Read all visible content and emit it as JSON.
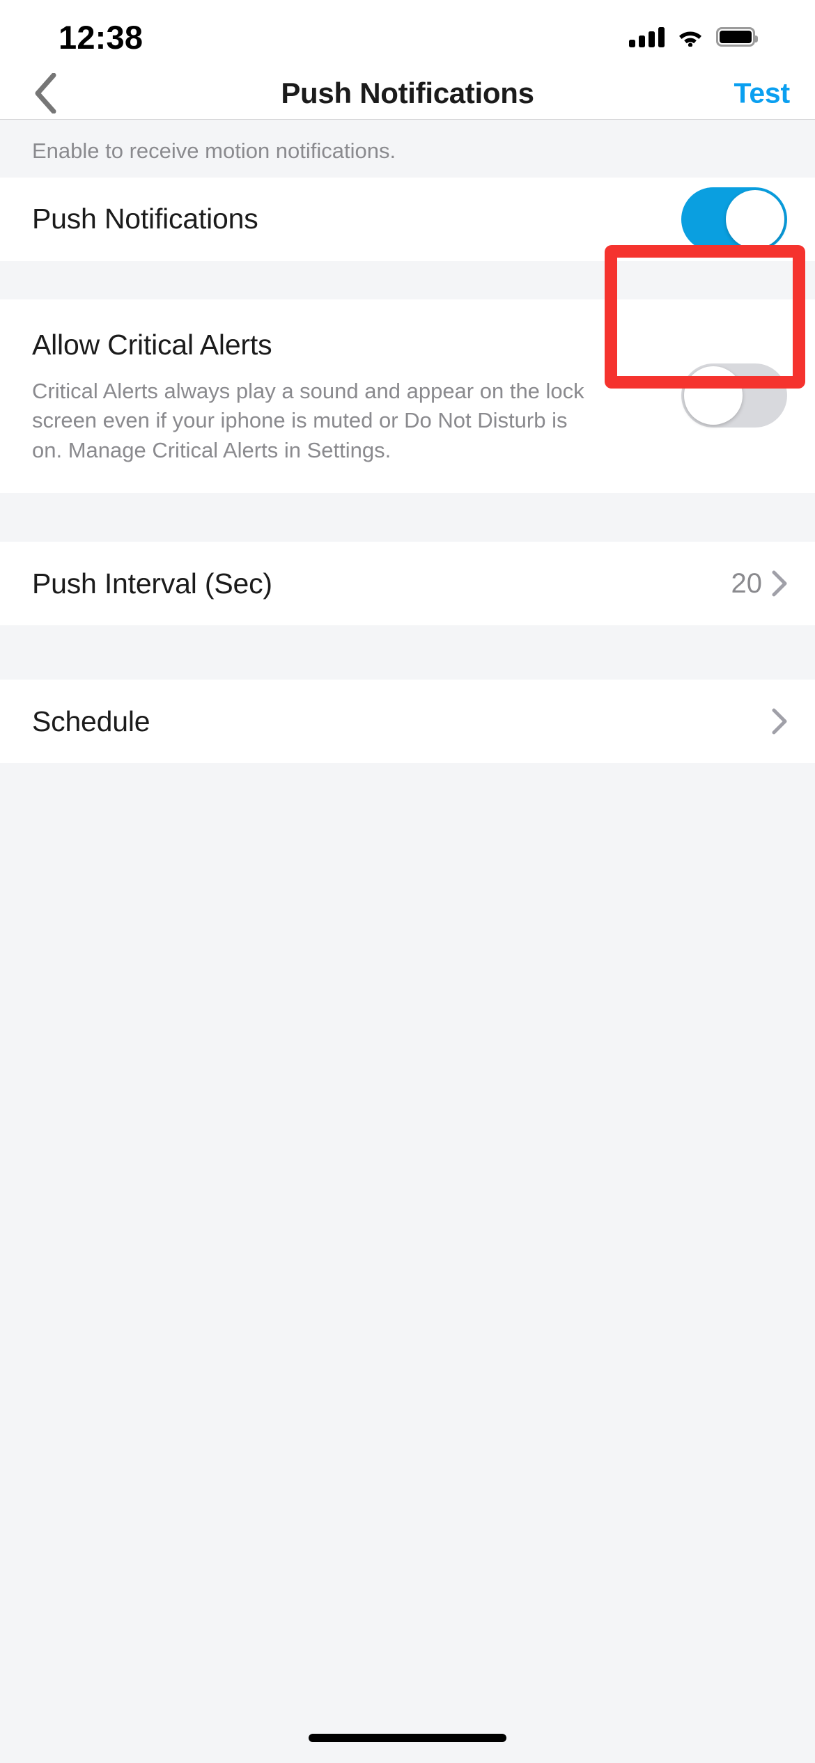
{
  "status_bar": {
    "time": "12:38",
    "cellular_icon": "cellular-signal-icon",
    "cellular_bars": 4,
    "wifi_icon": "wifi-icon",
    "battery_icon": "battery-full-icon"
  },
  "nav_bar": {
    "back_icon": "chevron-left-icon",
    "title": "Push Notifications",
    "action_label": "Test"
  },
  "sections": {
    "push": {
      "footer_text": "Enable to receive motion notifications.",
      "row_label": "Push Notifications",
      "toggle_state": "on",
      "toggle_name": "push-notifications-toggle"
    },
    "critical": {
      "title": "Allow Critical Alerts",
      "description": "Critical Alerts always play a sound and appear on the lock screen even if your iphone is muted or Do Not Disturb is on. Manage Critical Alerts in Settings.",
      "toggle_state": "off",
      "toggle_name": "allow-critical-alerts-toggle"
    },
    "interval": {
      "label": "Push Interval (Sec)",
      "value": "20",
      "chevron_icon": "chevron-right-icon"
    },
    "schedule": {
      "label": "Schedule",
      "chevron_icon": "chevron-right-icon"
    }
  },
  "annotation": {
    "type": "highlight-rectangle",
    "target": "push-notifications-toggle",
    "color": "#f5332e"
  },
  "colors": {
    "accent_blue": "#0a9ff0",
    "toggle_on": "#0a9fe0",
    "toggle_off": "#d8d9dd",
    "background": "#f4f5f7",
    "card": "#ffffff",
    "secondary_text": "#8a8a8e",
    "primary_text": "#1b1b1b",
    "highlight_red": "#f5332e"
  },
  "home_indicator": "home-indicator"
}
